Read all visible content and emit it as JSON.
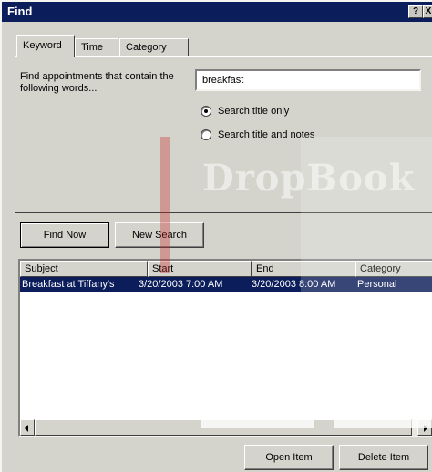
{
  "window": {
    "title": "Find",
    "help_label": "?",
    "close_label": "X"
  },
  "tabs": [
    {
      "label": "Keyword",
      "active": true
    },
    {
      "label": "Time",
      "active": false
    },
    {
      "label": "Category",
      "active": false
    }
  ],
  "keyword": {
    "find_label": "Find appointments that contain the following words...",
    "search_value": "breakfast",
    "options": [
      {
        "label": "Search title only",
        "checked": true
      },
      {
        "label": "Search title and notes",
        "checked": false
      }
    ]
  },
  "actions": {
    "find_now": "Find Now",
    "new_search": "New Search",
    "open_item": "Open Item",
    "delete_item": "Delete Item"
  },
  "results": {
    "columns": [
      "Subject",
      "Start",
      "End",
      "Category"
    ],
    "rows": [
      {
        "subject": "Breakfast at Tiffany's",
        "start": "3/20/2003 7:00 AM",
        "end": "3/20/2003 8:00 AM",
        "category": "Personal",
        "selected": true
      }
    ]
  },
  "watermark": {
    "text": "DropBook"
  },
  "colors": {
    "titlebar": "#0b1d5a",
    "dialog_bg": "#d4d4cc",
    "selection": "#0b1d5a",
    "desktop": "#56b8c8"
  }
}
